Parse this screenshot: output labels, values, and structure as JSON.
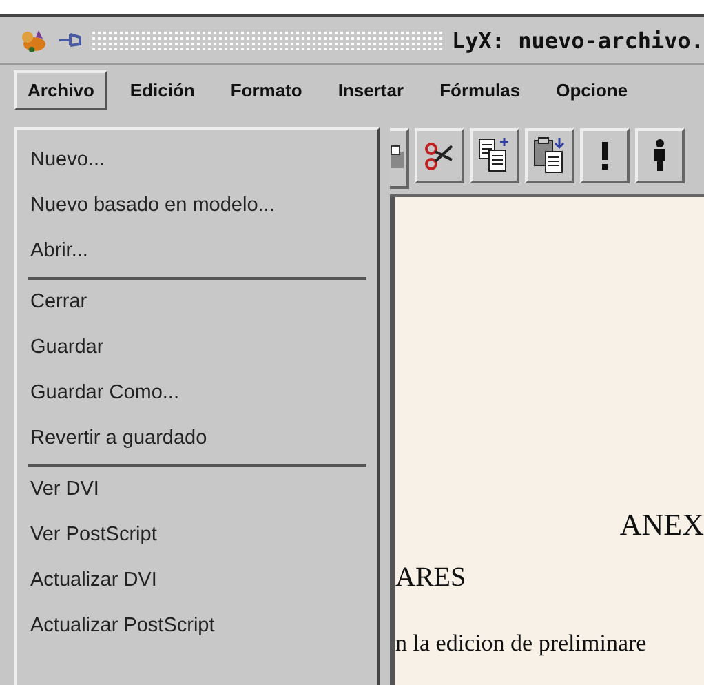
{
  "window": {
    "title": "LyX: nuevo-archivo."
  },
  "menubar": [
    {
      "label": "Archivo",
      "selected": true
    },
    {
      "label": "Edición",
      "selected": false
    },
    {
      "label": "Formato",
      "selected": false
    },
    {
      "label": "Insertar",
      "selected": false
    },
    {
      "label": "Fórmulas",
      "selected": false
    },
    {
      "label": "Opcione",
      "selected": false
    }
  ],
  "menu": [
    {
      "kind": "item",
      "label": "Nuevo..."
    },
    {
      "kind": "item",
      "label": "Nuevo basado en modelo..."
    },
    {
      "kind": "item",
      "label": "Abrir..."
    },
    {
      "kind": "separator"
    },
    {
      "kind": "item",
      "label": "Cerrar"
    },
    {
      "kind": "item",
      "label": "Guardar"
    },
    {
      "kind": "item",
      "label": "Guardar Como..."
    },
    {
      "kind": "item",
      "label": "Revertir a guardado"
    },
    {
      "kind": "separator"
    },
    {
      "kind": "item",
      "label": "Ver DVI"
    },
    {
      "kind": "item",
      "label": "Ver PostScript"
    },
    {
      "kind": "item",
      "label": "Actualizar DVI"
    },
    {
      "kind": "item",
      "label": "Actualizar PostScript"
    }
  ],
  "document": {
    "heading": "ANEX",
    "section": "ARES",
    "paragraph": "n la edicion de preliminare"
  }
}
